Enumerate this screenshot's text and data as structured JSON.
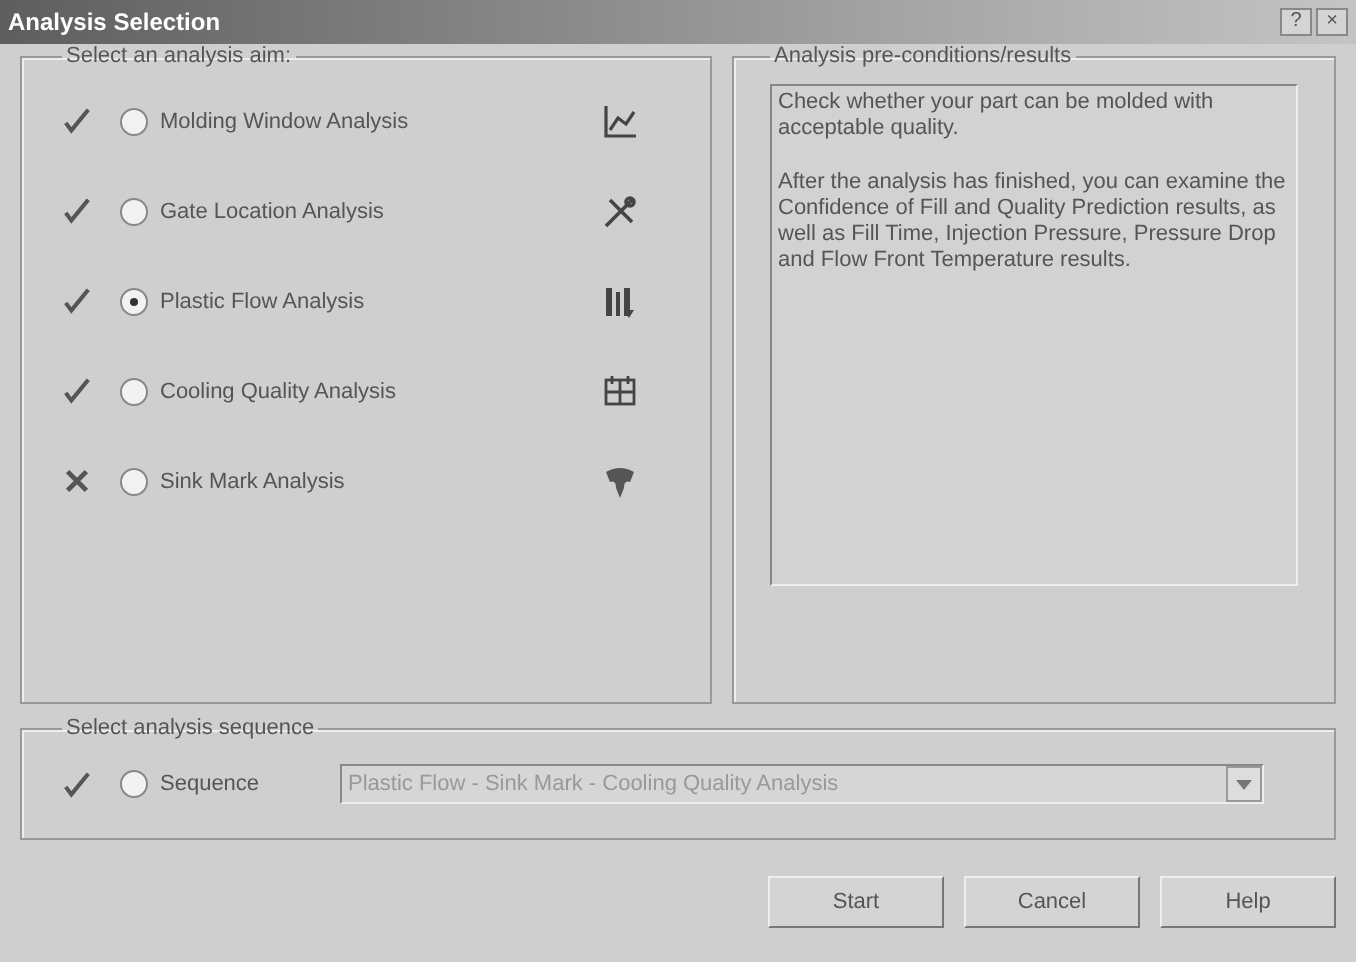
{
  "window": {
    "title": "Analysis Selection",
    "controls": [
      "?",
      "×"
    ]
  },
  "aim_group": {
    "title": "Select an analysis aim:",
    "options": [
      {
        "label": "Molding Window Analysis",
        "available": true,
        "selected": false
      },
      {
        "label": "Gate Location Analysis",
        "available": true,
        "selected": false
      },
      {
        "label": "Plastic Flow Analysis",
        "available": true,
        "selected": true
      },
      {
        "label": "Cooling Quality Analysis",
        "available": true,
        "selected": false
      },
      {
        "label": "Sink Mark Analysis",
        "available": false,
        "selected": false
      }
    ]
  },
  "results_group": {
    "title": "Analysis pre-conditions/results",
    "paragraphs": [
      "Check whether your part can be molded with acceptable quality.",
      "After the analysis has finished, you can examine the Confidence of Fill and Quality Prediction results, as well as Fill Time, Injection Pressure, Pressure Drop and Flow Front Temperature results."
    ]
  },
  "sequence_group": {
    "title": "Select analysis sequence",
    "available": true,
    "label": "Sequence",
    "selected": false,
    "value": "Plastic Flow - Sink Mark - Cooling Quality Analysis",
    "disabled": true
  },
  "buttons": [
    "Start",
    "Cancel",
    "Help"
  ]
}
